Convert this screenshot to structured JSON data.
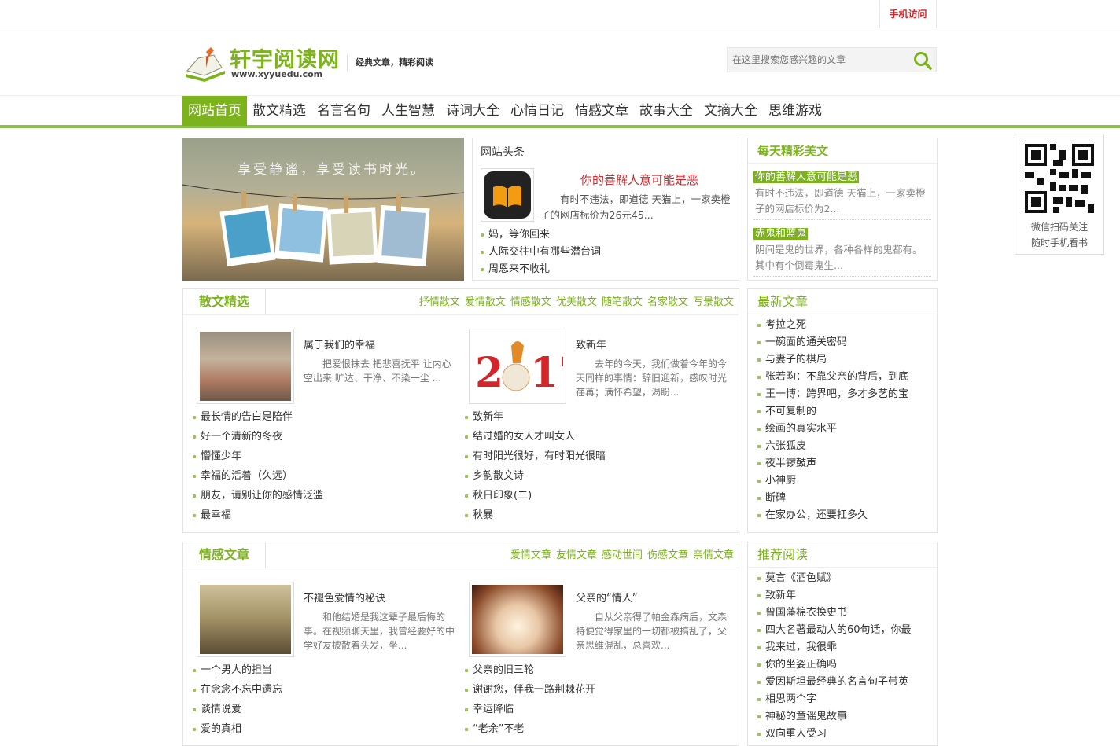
{
  "topbar": {
    "mobile_label": "手机访问"
  },
  "header": {
    "logo_cn": "轩宇阅读网",
    "logo_en": "www.xyyuedu.com",
    "slogan": "经典文章，精彩阅读",
    "search_placeholder": "在这里搜索您感兴趣的文章"
  },
  "nav": [
    "网站首页",
    "散文精选",
    "名言名句",
    "人生智慧",
    "诗词大全",
    "心情日记",
    "情感文章",
    "故事大全",
    "文摘大全",
    "思维游戏"
  ],
  "banner": {
    "text": "享受静谧，享受读书时光。"
  },
  "headline": {
    "title": "网站头条",
    "feature_title": "你的善解人意可能是恶",
    "feature_desc": "有时不违法，即道德 天猫上，一家卖橙子的网店标价为26元45...",
    "items": [
      "妈，等你回来",
      "人际交往中有哪些潜台词",
      "周恩来不收礼"
    ]
  },
  "daily": {
    "title": "每天精彩美文",
    "items": [
      {
        "tag": "你的善解人意可能是恶",
        "desc": "有时不违法，即道德 天猫上，一家卖橙子的网店标价为2..."
      },
      {
        "tag": "赤鬼和蓝鬼",
        "desc": "阴间是鬼的世界，各种各样的鬼都有。其中有个倒霉鬼生..."
      }
    ]
  },
  "qr": {
    "cap1": "微信扫码关注",
    "cap2": "随时手机看书"
  },
  "prose": {
    "title": "散文精选",
    "cats": [
      "抒情散文",
      "爱情散文",
      "情感散文",
      "优美散文",
      "随笔散文",
      "名家散文",
      "写景散文"
    ],
    "feature_left": {
      "title": "属于我们的幸福",
      "desc": "把爱恨抹去 把悲喜抚平 让内心空出来 旷达、干净、不染一尘 ..."
    },
    "feature_right": {
      "title": "致新年",
      "desc": "去年的今天，我们做着今年的今天同样的事情：辞旧迎新，感叹时光荏苒；满怀希望，渴盼..."
    },
    "list_left": [
      "最长情的告白是陪伴",
      "好一个清新的冬夜",
      "懵懂少年",
      "幸福的活着（久远）",
      "朋友，请别让你的感情泛滥",
      "最幸福"
    ],
    "list_right": [
      "致新年",
      "结过婚的女人才叫女人",
      "有时阳光很好，有时阳光很暗",
      "乡韵散文诗",
      "秋日印象(二)",
      "秋暴"
    ]
  },
  "emotion": {
    "title": "情感文章",
    "cats": [
      "爱情文章",
      "友情文章",
      "感动世间",
      "伤感文章",
      "亲情文章"
    ],
    "feature_left": {
      "title": "不褪色爱情的秘诀",
      "desc": "和他结婚是我这辈子最后悔的事。在视频聊天里，我曾经要好的中学好友披散着头发，坐..."
    },
    "feature_right": {
      "title": "父亲的“情人”",
      "desc": "自从父亲得了帕金森病后，文森特便觉得家里的一切都被搞乱了，父亲思维混乱，总喜欢..."
    },
    "list_left": [
      "一个男人的担当",
      "在念念不忘中遗忘",
      "谈情说爱",
      "爱的真相"
    ],
    "list_right": [
      "父亲的旧三轮",
      "谢谢您，伴我一路荆棘花开",
      "幸运降临",
      "“老余”不老"
    ]
  },
  "latest": {
    "title": "最新文章",
    "items": [
      "考拉之死",
      "一碗面的通关密码",
      "与妻子的棋局",
      "张若昀：不靠父亲的背后，到底",
      "王一博：跨界吧，多才多艺的宝",
      "不可复制的",
      "绘画的真实水平",
      "六张狐皮",
      "夜半锣鼓声",
      "小神厨",
      "断碑",
      "在家办公，还要扛多久"
    ]
  },
  "recommend": {
    "title": "推荐阅读",
    "items": [
      "莫言《酒色赋》",
      "致新年",
      "曾国藩棉衣换史书",
      "四大名著最动人的60句话，你最",
      "我来过，我很乖",
      "你的坐姿正确吗",
      "爱因斯坦最经典的名言句子带英",
      "相思两个字",
      "神秘的童谣鬼故事",
      "双向重人受习"
    ]
  }
}
